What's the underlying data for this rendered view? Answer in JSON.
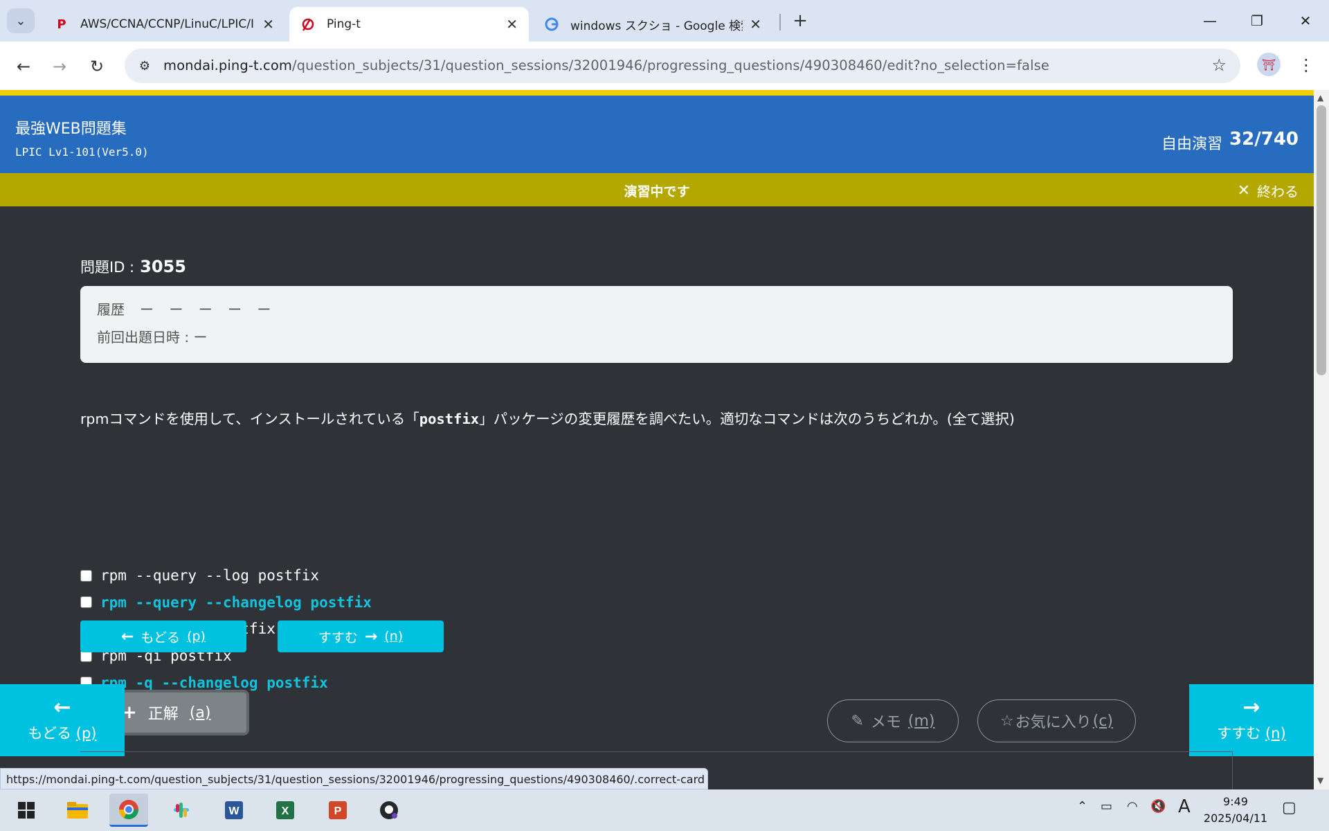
{
  "browser": {
    "tabs": [
      {
        "title": "AWS/CCNA/CCNP/LinuC/LPIC/I",
        "favicon": "P"
      },
      {
        "title": "Ping-t",
        "favicon": "ping-t-logo"
      },
      {
        "title": "windows スクショ - Google 検索",
        "favicon": "G"
      }
    ],
    "url_host": "mondai.ping-t.com",
    "url_path": "/question_subjects/31/question_sessions/32001946/progressing_questions/490308460/edit?no_selection=false",
    "status_url": "https://mondai.ping-t.com/question_subjects/31/question_sessions/32001946/progressing_questions/490308460/.correct-card"
  },
  "header": {
    "brand": "最強WEB問題集",
    "course": "LPIC Lv1-101(Ver5.0)",
    "mode": "自由演習",
    "progress": "32/740"
  },
  "status": {
    "message": "演習中です",
    "end_label": "終わる"
  },
  "question": {
    "id_label": "問題ID :",
    "id": "3055",
    "history_label": "履歴",
    "history_marks": "ー ー ー ー ー",
    "last_date_label": "前回出題日時 : ー",
    "text_pre": "rpmコマンドを使用して、インストールされている「",
    "text_code": "postfix",
    "text_post": "」パッケージの変更履歴を調べたい。適切なコマンドは次のうちどれか。(全て選択)",
    "options": [
      {
        "text": "rpm --query --log postfix",
        "highlight": false
      },
      {
        "text": "rpm --query --changelog postfix",
        "highlight": true
      },
      {
        "text": "rpm -q --log postfix",
        "highlight": false
      },
      {
        "text": "rpm -qi postfix",
        "highlight": false
      },
      {
        "text": "rpm -q --changelog postfix",
        "highlight": true
      }
    ]
  },
  "buttons": {
    "back_label": "もどる",
    "back_key": "(p)",
    "next_label": "すすむ",
    "next_key": "(n)",
    "answer_label": "正解",
    "answer_key": "(a)",
    "memo_label": "メモ",
    "memo_key": "(m)",
    "fav_label": "お気に入り",
    "fav_key": "(c)"
  },
  "taskbar": {
    "time": "9:49",
    "date": "2025/04/11",
    "ime": "A"
  },
  "colors": {
    "header_blue": "#276cbe",
    "status_olive": "#b4a800",
    "accent_cyan": "#00c2e0",
    "highlight_cyan": "#13c3dd"
  }
}
